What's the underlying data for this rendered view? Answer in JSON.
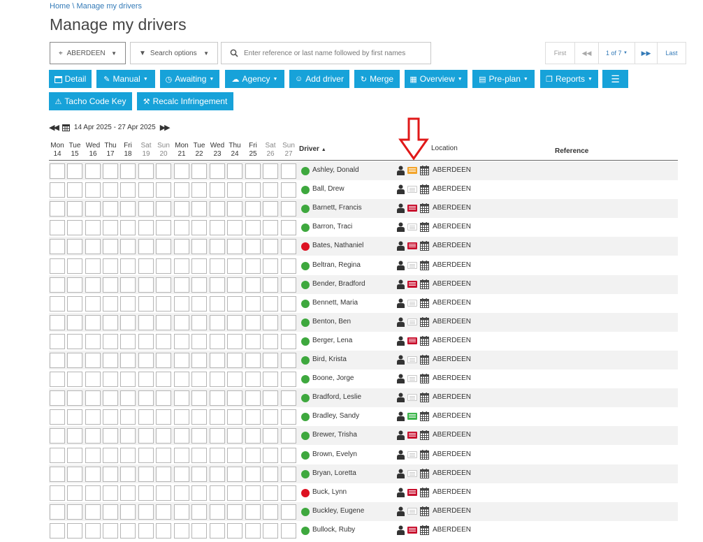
{
  "breadcrumb": "Home \\ Manage my drivers",
  "title": "Manage my drivers",
  "toolbar": {
    "depot": "ABERDEEN",
    "search_options": "Search options",
    "search_placeholder": "Enter reference or last name followed by first names"
  },
  "pager": {
    "first": "First",
    "page": "1 of 7",
    "last": "Last"
  },
  "buttons": {
    "detail": "Detail",
    "manual": "Manual",
    "awaiting": "Awaiting",
    "agency": "Agency",
    "add_driver": "Add driver",
    "merge": "Merge",
    "overview": "Overview",
    "preplan": "Pre-plan",
    "reports": "Reports",
    "tacho": "Tacho Code Key",
    "recalc": "Recalc Infringement"
  },
  "date_range": "14 Apr 2025 - 27 Apr 2025",
  "days": [
    {
      "d": "Mon",
      "n": "14",
      "weekend": false
    },
    {
      "d": "Tue",
      "n": "15",
      "weekend": false
    },
    {
      "d": "Wed",
      "n": "16",
      "weekend": false
    },
    {
      "d": "Thu",
      "n": "17",
      "weekend": false
    },
    {
      "d": "Fri",
      "n": "18",
      "weekend": false
    },
    {
      "d": "Sat",
      "n": "19",
      "weekend": true
    },
    {
      "d": "Sun",
      "n": "20",
      "weekend": true
    },
    {
      "d": "Mon",
      "n": "21",
      "weekend": false
    },
    {
      "d": "Tue",
      "n": "22",
      "weekend": false
    },
    {
      "d": "Wed",
      "n": "23",
      "weekend": false
    },
    {
      "d": "Thu",
      "n": "24",
      "weekend": false
    },
    {
      "d": "Fri",
      "n": "25",
      "weekend": false
    },
    {
      "d": "Sat",
      "n": "26",
      "weekend": true
    },
    {
      "d": "Sun",
      "n": "27",
      "weekend": true
    }
  ],
  "columns": {
    "driver": "Driver",
    "location": "Location",
    "reference": "Reference"
  },
  "status_colors": {
    "green": "#3ea83e",
    "red": "#dd1122"
  },
  "drivers": [
    {
      "name": "Ashley, Donald",
      "status": "green",
      "card": "orange",
      "location": "ABERDEEN"
    },
    {
      "name": "Ball, Drew",
      "status": "green",
      "card": "grey",
      "location": "ABERDEEN"
    },
    {
      "name": "Barnett, Francis",
      "status": "green",
      "card": "red",
      "location": "ABERDEEN"
    },
    {
      "name": "Barron, Traci",
      "status": "green",
      "card": "grey",
      "location": "ABERDEEN"
    },
    {
      "name": "Bates, Nathaniel",
      "status": "red",
      "card": "red",
      "location": "ABERDEEN"
    },
    {
      "name": "Beltran, Regina",
      "status": "green",
      "card": "grey",
      "location": "ABERDEEN"
    },
    {
      "name": "Bender, Bradford",
      "status": "green",
      "card": "red",
      "location": "ABERDEEN"
    },
    {
      "name": "Bennett, Maria",
      "status": "green",
      "card": "grey",
      "location": "ABERDEEN"
    },
    {
      "name": "Benton, Ben",
      "status": "green",
      "card": "grey",
      "location": "ABERDEEN"
    },
    {
      "name": "Berger, Lena",
      "status": "green",
      "card": "red",
      "location": "ABERDEEN"
    },
    {
      "name": "Bird, Krista",
      "status": "green",
      "card": "grey",
      "location": "ABERDEEN"
    },
    {
      "name": "Boone, Jorge",
      "status": "green",
      "card": "grey",
      "location": "ABERDEEN"
    },
    {
      "name": "Bradford, Leslie",
      "status": "green",
      "card": "grey",
      "location": "ABERDEEN"
    },
    {
      "name": "Bradley, Sandy",
      "status": "green",
      "card": "green",
      "location": "ABERDEEN"
    },
    {
      "name": "Brewer, Trisha",
      "status": "green",
      "card": "red",
      "location": "ABERDEEN"
    },
    {
      "name": "Brown, Evelyn",
      "status": "green",
      "card": "grey",
      "location": "ABERDEEN"
    },
    {
      "name": "Bryan, Loretta",
      "status": "green",
      "card": "grey",
      "location": "ABERDEEN"
    },
    {
      "name": "Buck, Lynn",
      "status": "red",
      "card": "red",
      "location": "ABERDEEN"
    },
    {
      "name": "Buckley, Eugene",
      "status": "green",
      "card": "grey",
      "location": "ABERDEEN"
    },
    {
      "name": "Bullock, Ruby",
      "status": "green",
      "card": "red",
      "location": "ABERDEEN"
    }
  ]
}
